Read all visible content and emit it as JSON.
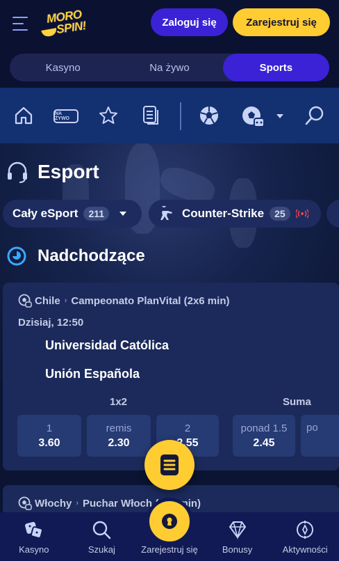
{
  "header": {
    "logo_text_line1": "MORO",
    "logo_text_line2": "SPIN!",
    "login_label": "Zaloguj się",
    "register_label": "Zarejestruj się"
  },
  "main_tabs": [
    {
      "label": "Kasyno",
      "active": false
    },
    {
      "label": "Na żywo",
      "active": false
    },
    {
      "label": "Sports",
      "active": true
    }
  ],
  "sport_nav": {
    "live_badge_text": "NA ŻYWO",
    "icons": [
      "home-icon",
      "live-icon",
      "star-icon",
      "betslip-history-icon",
      "soccer-ball-icon",
      "virtual-sport-icon",
      "chevron-down-icon",
      "search-icon"
    ]
  },
  "esport": {
    "title": "Esport",
    "filters": [
      {
        "label": "Cały eSport",
        "count": "211"
      },
      {
        "label": "Counter-Strike",
        "count": "25"
      }
    ]
  },
  "upcoming": {
    "title": "Nadchodzące"
  },
  "matches": [
    {
      "country": "Chile",
      "league": "Campeonato PlanVital (2x6 min)",
      "datetime": "Dzisiaj, 12:50",
      "team1": "Universidad Católica",
      "team2": "Unión Española",
      "market1_label": "1x2",
      "market2_label": "Suma",
      "odds": [
        {
          "label": "1",
          "value": "3.60"
        },
        {
          "label": "remis",
          "value": "2.30"
        },
        {
          "label": "2",
          "value": "2.55"
        },
        {
          "label": "ponad 1.5",
          "value": "2.45"
        },
        {
          "label": "po",
          "value": ""
        }
      ]
    },
    {
      "country": "Włochy",
      "league": "Puchar Włoch (2x6 min)"
    }
  ],
  "bottom_nav": [
    {
      "label": "Kasyno",
      "icon": "dice-icon"
    },
    {
      "label": "Szukaj",
      "icon": "search-icon"
    },
    {
      "label": "Zarejestruj się",
      "icon": "keyhole-icon"
    },
    {
      "label": "Bonusy",
      "icon": "diamond-icon"
    },
    {
      "label": "Aktywności",
      "icon": "compass-icon"
    }
  ],
  "colors": {
    "brand_yellow": "#ffcc32",
    "brand_purple": "#3b22d6",
    "background": "#0b1433",
    "live_red": "#e8454c"
  }
}
